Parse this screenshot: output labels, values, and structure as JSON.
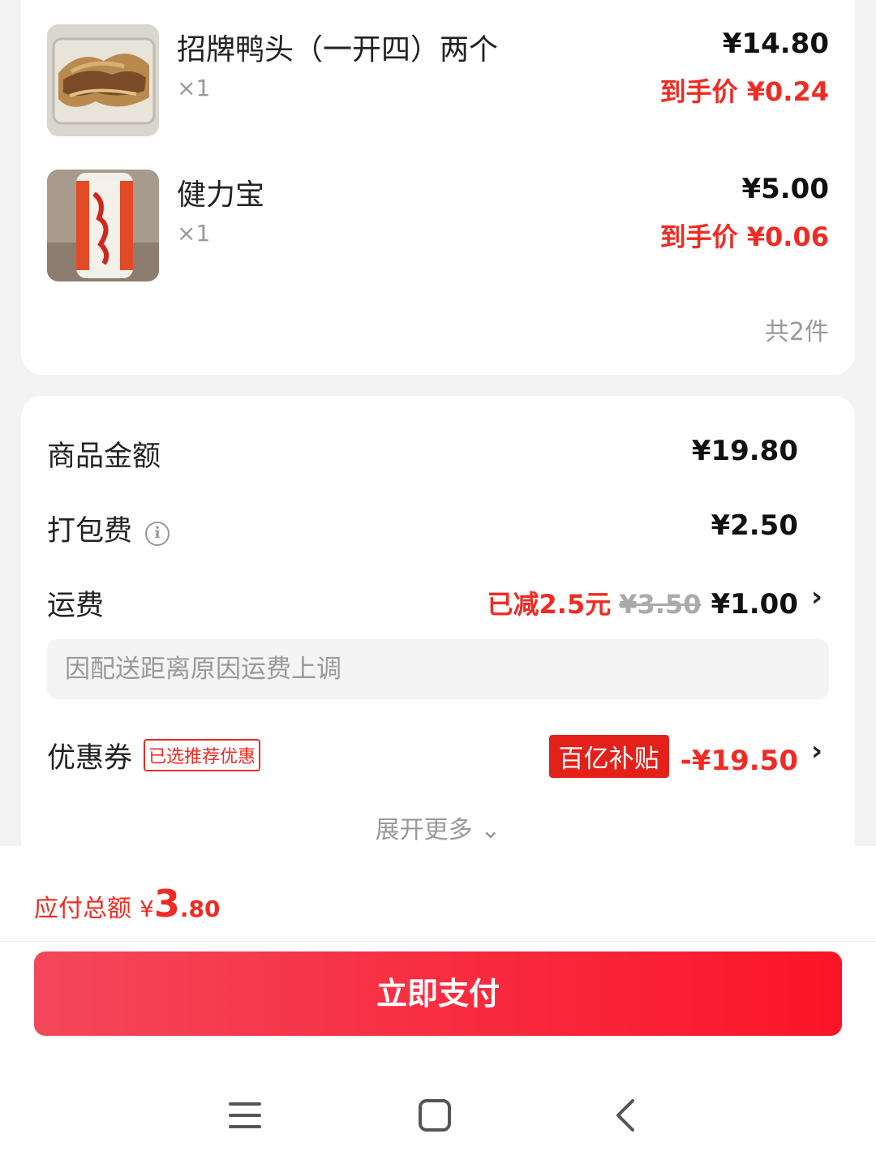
{
  "items": [
    {
      "name": "招牌鸭头（一开四）两个",
      "qty": "×1",
      "price": "¥14.80",
      "final_price": "到手价 ¥0.24",
      "thumb_icon": "duck-head-food-photo"
    },
    {
      "name": "健力宝",
      "qty": "×1",
      "price": "¥5.00",
      "final_price": "到手价 ¥0.06",
      "thumb_icon": "jianlibao-can-photo"
    }
  ],
  "count_text": "共2件",
  "fees": {
    "goods_label": "商品金额",
    "goods_value": "¥19.80",
    "pack_label": "打包费",
    "pack_value": "¥2.50",
    "pack_info_icon": "i",
    "ship_label": "运费",
    "ship_reduced": "已减2.5元",
    "ship_original": "¥3.50",
    "ship_value": "¥1.00",
    "ship_note": "因配送距离原因运费上调",
    "coupon_label": "优惠券",
    "coupon_tag": "已选推荐优惠",
    "coupon_badge": "百亿补贴",
    "coupon_value": "-¥19.50",
    "chevron": "›",
    "expand_text": "展开更多 ⌄"
  },
  "total": {
    "label": "应付总额",
    "yen": "¥",
    "int": "3",
    "dec": ".80"
  },
  "pay_button": "立即支付",
  "colors": {
    "accent": "#f02b23",
    "button_start": "#f4475a",
    "button_end": "#fb1428"
  }
}
